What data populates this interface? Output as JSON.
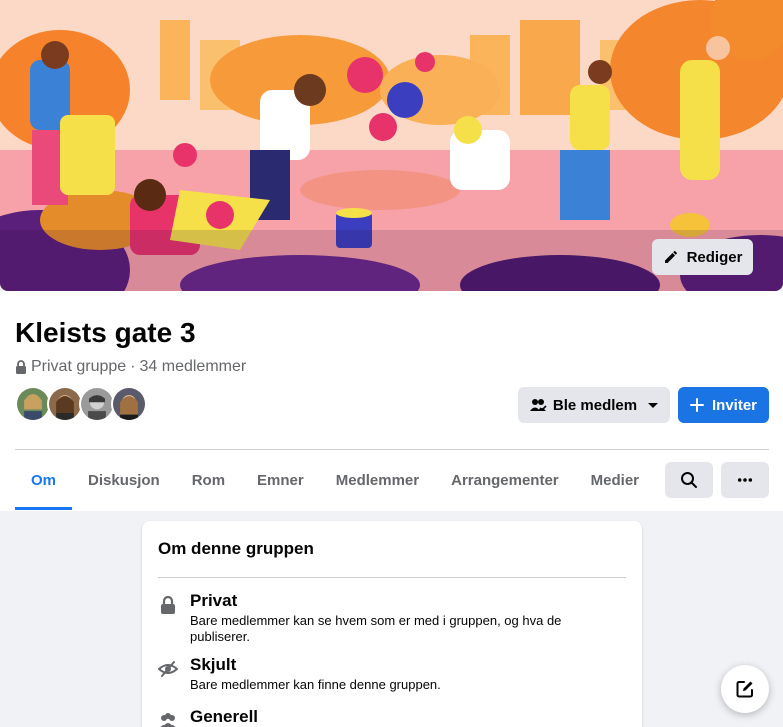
{
  "cover": {
    "edit_label": "Rediger"
  },
  "group": {
    "name": "Kleists gate 3",
    "privacy": "Privat gruppe",
    "separator": "·",
    "members": "34 medlemmer"
  },
  "actions": {
    "join_label": "Ble medlem",
    "invite_label": "Inviter"
  },
  "tabs": [
    {
      "label": "Om",
      "active": true
    },
    {
      "label": "Diskusjon"
    },
    {
      "label": "Rom"
    },
    {
      "label": "Emner"
    },
    {
      "label": "Medlemmer"
    },
    {
      "label": "Arrangementer"
    },
    {
      "label": "Medier"
    }
  ],
  "about": {
    "title": "Om denne gruppen",
    "items": [
      {
        "icon": "lock-icon",
        "title": "Privat",
        "desc": "Bare medlemmer kan se hvem som er med i gruppen, og hva de publiserer."
      },
      {
        "icon": "eye-slash-icon",
        "title": "Skjult",
        "desc": "Bare medlemmer kan finne denne gruppen."
      },
      {
        "icon": "people-icon",
        "title": "Generell",
        "desc": ""
      }
    ]
  },
  "colors": {
    "accent": "#1877f2",
    "button_gray": "#e4e6eb",
    "text_secondary": "#65676b"
  }
}
